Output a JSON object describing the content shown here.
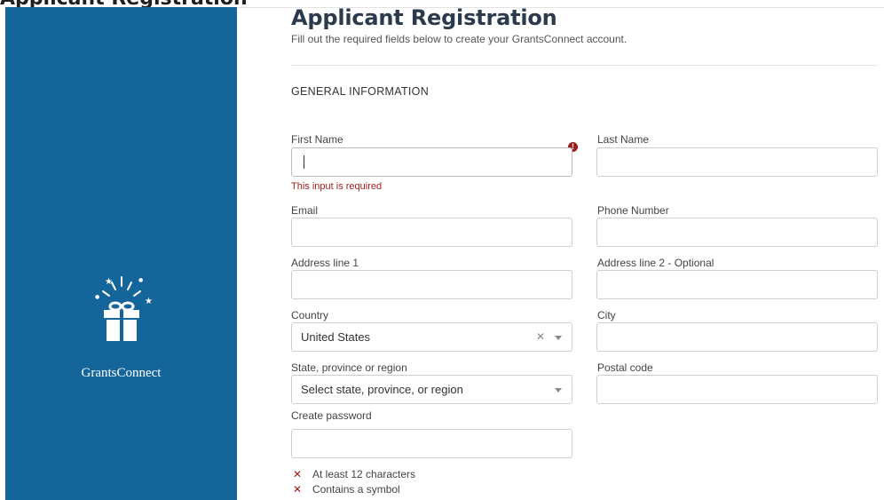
{
  "header": {
    "fragment_text": "Applicant Registration"
  },
  "sidebar": {
    "brand": "GrantsConnect",
    "bg_color": "#14659a"
  },
  "page": {
    "title": "Applicant Registration",
    "subtitle": "Fill out the required fields below to create your GrantsConnect account.",
    "section_title": "GENERAL INFORMATION"
  },
  "form": {
    "first_name": {
      "label": "First Name",
      "value": "",
      "error": "This input is required"
    },
    "last_name": {
      "label": "Last Name",
      "value": ""
    },
    "email": {
      "label": "Email",
      "value": ""
    },
    "phone": {
      "label": "Phone Number",
      "value": ""
    },
    "address1": {
      "label": "Address line 1",
      "value": ""
    },
    "address2": {
      "label": "Address line 2 - Optional",
      "value": ""
    },
    "country": {
      "label": "Country",
      "value": "United States"
    },
    "city": {
      "label": "City",
      "value": ""
    },
    "state": {
      "label": "State, province or region",
      "placeholder": "Select state, province, or region"
    },
    "postal": {
      "label": "Postal code",
      "value": ""
    },
    "password": {
      "label": "Create password",
      "value": ""
    }
  },
  "password_rules": [
    "At least 12 characters",
    "Contains a symbol"
  ],
  "colors": {
    "error": "#a11d1d",
    "title": "#2b3a4d"
  }
}
